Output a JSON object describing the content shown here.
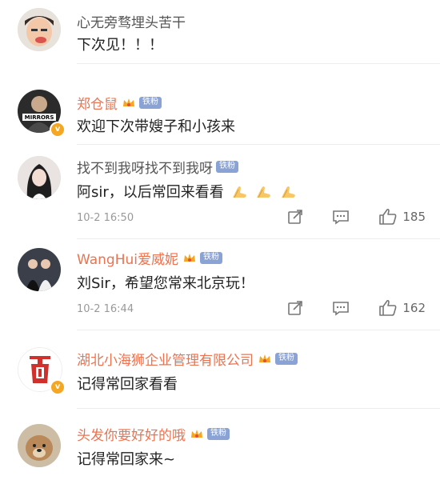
{
  "comments": [
    {
      "name": "心无旁骛埋头苦干",
      "text": "下次见！！！"
    },
    {
      "name": "郑仓鼠",
      "badge": "铁粉",
      "text": "欢迎下次带嫂子和小孩来",
      "avatar_caption": "MIRRORS"
    },
    {
      "name": "找不到我呀找不到我呀",
      "badge": "铁粉",
      "text": "阿sir，以后常回来看看",
      "time": "10-2 16:50",
      "likes": "185"
    },
    {
      "name": "WangHui爱威妮",
      "badge": "铁粉",
      "text": "刘Sir，希望您常来北京玩！",
      "time": "10-2 16:44",
      "likes": "162"
    },
    {
      "name": "湖北小海狮企业管理有限公司",
      "badge": "铁粉",
      "text": "记得常回家看看"
    },
    {
      "name": "头发你要好好的哦",
      "badge": "铁粉",
      "text": "记得常回家来~"
    }
  ],
  "colors": {
    "name_highlight": "#eb7350",
    "fan_badge": "#8aa3d6",
    "verified": "#f5a623"
  },
  "icons": [
    "share-icon",
    "comment-icon",
    "like-icon",
    "crown-icon",
    "verified-icon",
    "pray-emoji-icon"
  ]
}
